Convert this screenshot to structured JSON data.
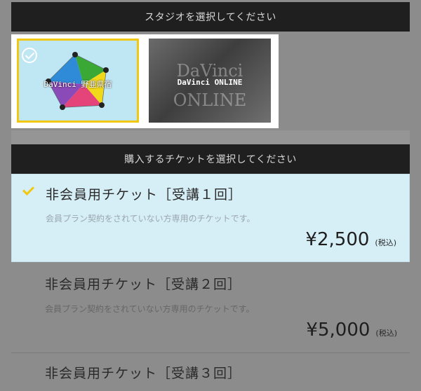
{
  "studio_section": {
    "header": "スタジオを選択してください",
    "studios": [
      {
        "name": "DaVinci 野亜県宿",
        "selected": true
      },
      {
        "name": "DaVinci ONLINE",
        "watermark_line1": "DaVinci",
        "watermark_line2": "ONLINE",
        "selected": false
      }
    ]
  },
  "ticket_section": {
    "header": "購入するチケットを選択してください",
    "tickets": [
      {
        "title": "非会員用チケット［受講１回］",
        "description": "会員プラン契約をされていない方専用のチケットです。",
        "price": "¥2,500",
        "tax_note": "(税込)",
        "selected": true
      },
      {
        "title": "非会員用チケット［受講２回］",
        "description": "会員プラン契約をされていない方専用のチケットです。",
        "price": "¥5,000",
        "tax_note": "(税込)",
        "selected": false
      },
      {
        "title": "非会員用チケット［受講３回］",
        "selected": false
      }
    ]
  },
  "colors": {
    "accent": "#f2c80f",
    "selected_bg": "#d6eef6",
    "header_bg": "#1f1f1f",
    "overlay": "#8c8c8c"
  }
}
